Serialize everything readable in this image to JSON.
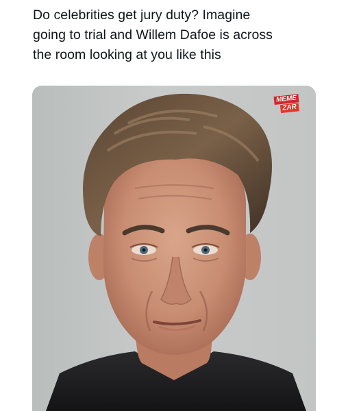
{
  "post": {
    "text_lines": [
      "Do celebrities get jury duty? Imagine",
      "going to trial and Willem Dafoe is across",
      "the room looking at you like this"
    ]
  },
  "photo": {
    "watermark_lines": [
      "MEME",
      "ZAR"
    ],
    "background_color": "#c3c6c5"
  }
}
